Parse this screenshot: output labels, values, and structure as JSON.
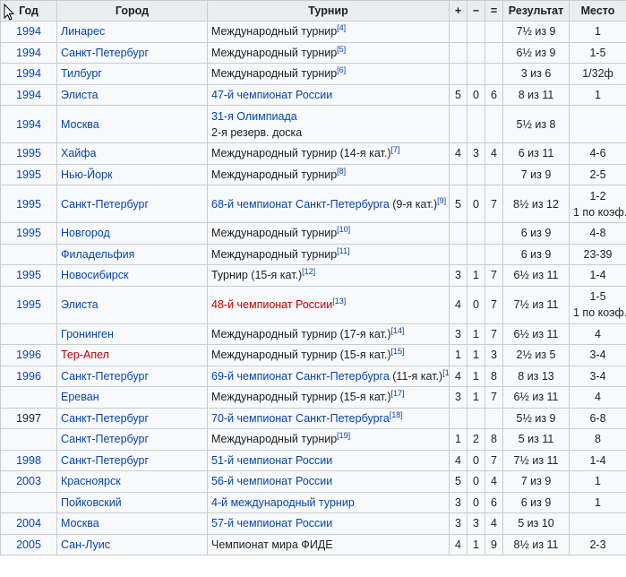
{
  "headers": {
    "year": "Год",
    "city": "Город",
    "tournament": "Турнир",
    "plus": "+",
    "minus": "−",
    "eq": "=",
    "result": "Результат",
    "place": "Место"
  },
  "rows": [
    {
      "year": "1994",
      "city": "Линарес",
      "tournament": "Международный турнир",
      "t_link": false,
      "ref": "[4]",
      "plus": "",
      "minus": "",
      "eq": "",
      "result": "7½ из 9",
      "place": "1"
    },
    {
      "year": "1994",
      "city": "Санкт-Петербург",
      "tournament": "Международный турнир",
      "t_link": false,
      "ref": "[5]",
      "plus": "",
      "minus": "",
      "eq": "",
      "result": "6½ из 9",
      "place": "1-5"
    },
    {
      "year": "1994",
      "city": "Тилбург",
      "tournament": "Международный турнир",
      "t_link": false,
      "ref": "[6]",
      "plus": "",
      "minus": "",
      "eq": "",
      "result": "3 из 6",
      "place": "1/32ф"
    },
    {
      "year": "1994",
      "city": "Элиста",
      "tournament": "47-й чемпионат России",
      "t_link": true,
      "ref": "",
      "plus": "5",
      "minus": "0",
      "eq": "6",
      "result": "8 из 11",
      "place": "1"
    },
    {
      "year": "1994",
      "city": "Москва",
      "tournament": "31-я Олимпиада",
      "t_link": true,
      "t_line2": "2-я резерв. доска",
      "ref": "",
      "plus": "",
      "minus": "",
      "eq": "",
      "result": "5½ из 8",
      "place": "",
      "tall": true
    },
    {
      "year": "1995",
      "city": "Хайфа",
      "tournament": "Международный турнир (14-я кат.)",
      "t_link": false,
      "ref": "[7]",
      "plus": "4",
      "minus": "3",
      "eq": "4",
      "result": "6 из 11",
      "place": "4-6"
    },
    {
      "year": "1995",
      "city": "Нью-Йорк",
      "tournament": "Международный турнир",
      "t_link": false,
      "ref": "[8]",
      "plus": "",
      "minus": "",
      "eq": "",
      "result": "7 из 9",
      "place": "2-5"
    },
    {
      "year": "1995",
      "city": "Санкт-Петербург",
      "tournament": "68-й чемпионат Санкт-Петербурга",
      "t_link": true,
      "t_suffix": " (9-я кат.)",
      "ref": "[9]",
      "plus": "5",
      "minus": "0",
      "eq": "7",
      "result": "8½ из 12",
      "place": "1-2",
      "place2": "1 по коэф.",
      "tall": true
    },
    {
      "year": "1995",
      "city": "Новгород",
      "tournament": "Международный турнир",
      "t_link": false,
      "ref": "[10]",
      "plus": "",
      "minus": "",
      "eq": "",
      "result": "6 из 9",
      "place": "4-8"
    },
    {
      "year": "",
      "city": "Филадельфия",
      "tournament": "Международный турнир",
      "t_link": false,
      "ref": "[11]",
      "plus": "",
      "minus": "",
      "eq": "",
      "result": "6 из 9",
      "place": "23-39"
    },
    {
      "year": "1995",
      "city": "Новосибирск",
      "tournament": "Турнир (15-я кат.)",
      "t_link": false,
      "ref": "[12]",
      "plus": "3",
      "minus": "1",
      "eq": "7",
      "result": "6½ из 11",
      "place": "1-4"
    },
    {
      "year": "1995",
      "city": "Элиста",
      "tournament": "48-й чемпионат России",
      "t_link": true,
      "t_red": true,
      "ref": "[13]",
      "plus": "4",
      "minus": "0",
      "eq": "7",
      "result": "7½ из 11",
      "place": "1-5",
      "place2": "1 по коэф.",
      "tall": true
    },
    {
      "year": "",
      "city": "Гронинген",
      "tournament": "Международный турнир (17-я кат.)",
      "t_link": false,
      "ref": "[14]",
      "plus": "3",
      "minus": "1",
      "eq": "7",
      "result": "6½ из 11",
      "place": "4"
    },
    {
      "year": "1996",
      "city": "Тер-Апел",
      "city_red": true,
      "tournament": "Международный турнир (15-я кат.)",
      "t_link": false,
      "ref": "[15]",
      "plus": "1",
      "minus": "1",
      "eq": "3",
      "result": "2½ из 5",
      "place": "3-4"
    },
    {
      "year": "1996",
      "city": "Санкт-Петербург",
      "tournament": "69-й чемпионат Санкт-Петербурга",
      "t_link": true,
      "t_suffix": " (11-я кат.)",
      "ref": "[16]",
      "plus": "4",
      "minus": "1",
      "eq": "8",
      "result": "8 из 13",
      "place": "3-4"
    },
    {
      "year": "",
      "city": "Ереван",
      "tournament": "Международный турнир (15-я кат.)",
      "t_link": false,
      "ref": "[17]",
      "plus": "3",
      "minus": "1",
      "eq": "7",
      "result": "6½ из 11",
      "place": "4"
    },
    {
      "year": "1997",
      "year_plain": true,
      "city": "Санкт-Петербург",
      "tournament": "70-й чемпионат Санкт-Петербурга",
      "t_link": true,
      "ref": "[18]",
      "plus": "",
      "minus": "",
      "eq": "",
      "result": "5½ из 9",
      "place": "6-8"
    },
    {
      "year": "",
      "city": "Санкт-Петербург",
      "tournament": "Международный турнир",
      "t_link": false,
      "ref": "[19]",
      "plus": "1",
      "minus": "2",
      "eq": "8",
      "result": "5 из 11",
      "place": "8"
    },
    {
      "year": "1998",
      "city": "Санкт-Петербург",
      "tournament": "51-й чемпионат России",
      "t_link": true,
      "ref": "",
      "plus": "4",
      "minus": "0",
      "eq": "7",
      "result": "7½ из 11",
      "place": "1-4"
    },
    {
      "year": "2003",
      "city": "Красноярск",
      "tournament": "56-й чемпионат России",
      "t_link": true,
      "ref": "",
      "plus": "5",
      "minus": "0",
      "eq": "4",
      "result": "7 из 9",
      "place": "1"
    },
    {
      "year": "",
      "city": "Пойковский",
      "tournament": "4-й международный турнир",
      "t_link": true,
      "ref": "",
      "plus": "3",
      "minus": "0",
      "eq": "6",
      "result": "6 из 9",
      "place": "1"
    },
    {
      "year": "2004",
      "city": "Москва",
      "tournament": "57-й чемпионат России",
      "t_link": true,
      "ref": "",
      "plus": "3",
      "minus": "3",
      "eq": "4",
      "result": "5 из 10",
      "place": ""
    },
    {
      "year": "2005",
      "city": "Сан-Луис",
      "tournament": "Чемпионат мира ФИДЕ",
      "t_link": false,
      "ref": "",
      "plus": "4",
      "minus": "1",
      "eq": "9",
      "result": "8½ из 11",
      "place": "2-3"
    }
  ]
}
